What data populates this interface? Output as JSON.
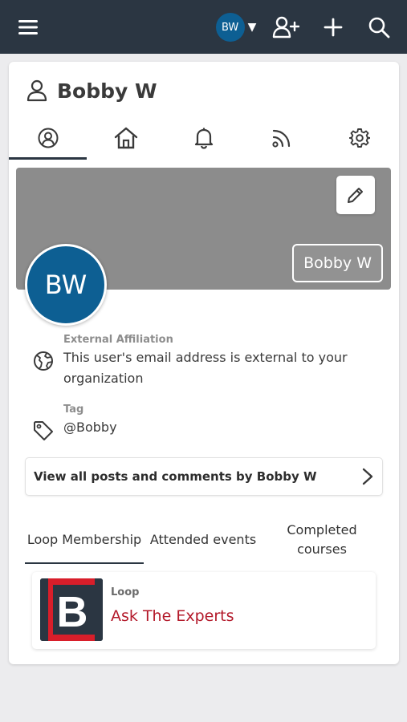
{
  "topbar": {
    "user_initials": "BW",
    "caret": "▼",
    "accent": "#2b3642",
    "avatar_color": "#0d5f93",
    "icons": [
      "hamburger-icon",
      "add-user-icon",
      "plus-icon",
      "search-icon"
    ]
  },
  "profile": {
    "name": "Bobby W",
    "initials": "BW",
    "cover_name": "Bobby W"
  },
  "tabs": [
    {
      "icon": "profile-icon",
      "active": true
    },
    {
      "icon": "home-icon",
      "active": false
    },
    {
      "icon": "bell-icon",
      "active": false
    },
    {
      "icon": "rss-icon",
      "active": false
    },
    {
      "icon": "gear-icon",
      "active": false
    }
  ],
  "info": {
    "affiliation_label": "External Affiliation",
    "affiliation_value": "This user's email address is external to your organization",
    "tag_label": "Tag",
    "tag_value": "@Bobby"
  },
  "view_posts_label": "View all posts and comments by Bobby W",
  "sub_tabs": {
    "loop_membership": "Loop Membership",
    "attended_events": "Attended events",
    "completed_courses": "Completed courses"
  },
  "loop_card": {
    "kicker": "Loop",
    "title": "Ask The Experts",
    "logo_letter": "B",
    "title_color": "#b3192a"
  }
}
